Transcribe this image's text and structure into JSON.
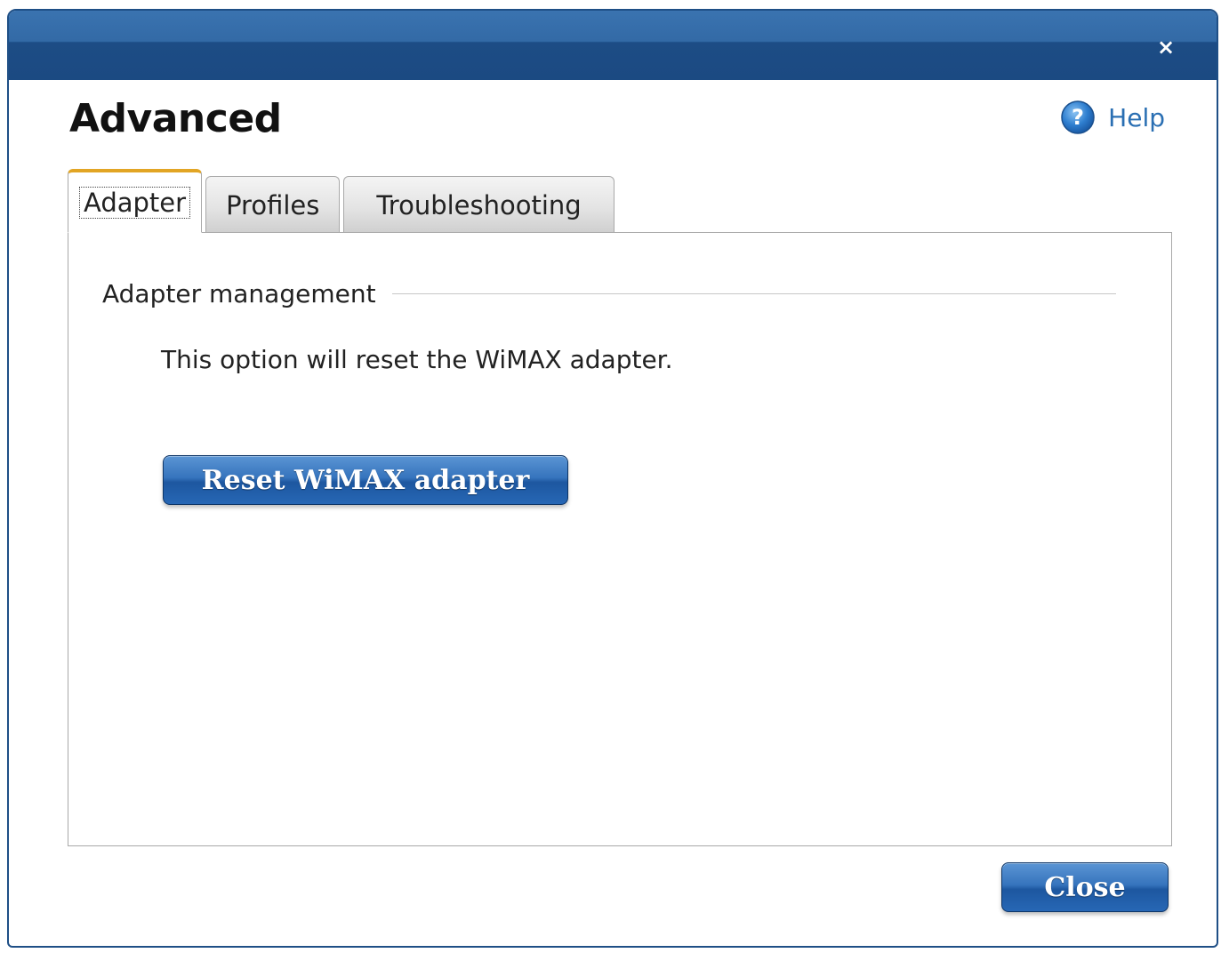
{
  "window": {
    "close_icon": "close-icon",
    "close_glyph": "×"
  },
  "header": {
    "title": "Advanced",
    "help_label": "Help",
    "help_icon": "question-mark-icon",
    "help_icon_glyph": "?"
  },
  "tabs": [
    {
      "label": "Adapter",
      "selected": true
    },
    {
      "label": "Profiles",
      "selected": false
    },
    {
      "label": "Troubleshooting",
      "selected": false
    }
  ],
  "adapter_panel": {
    "section_title": "Adapter management",
    "description": "This option will reset the WiMAX adapter.",
    "reset_button_label": "Reset WiMAX adapter"
  },
  "footer": {
    "close_button_label": "Close"
  },
  "colors": {
    "titlebar": "#1b4a82",
    "accent_tab": "#e2a524",
    "button_blue": "#2767b5",
    "help_link": "#2a6fb3"
  }
}
